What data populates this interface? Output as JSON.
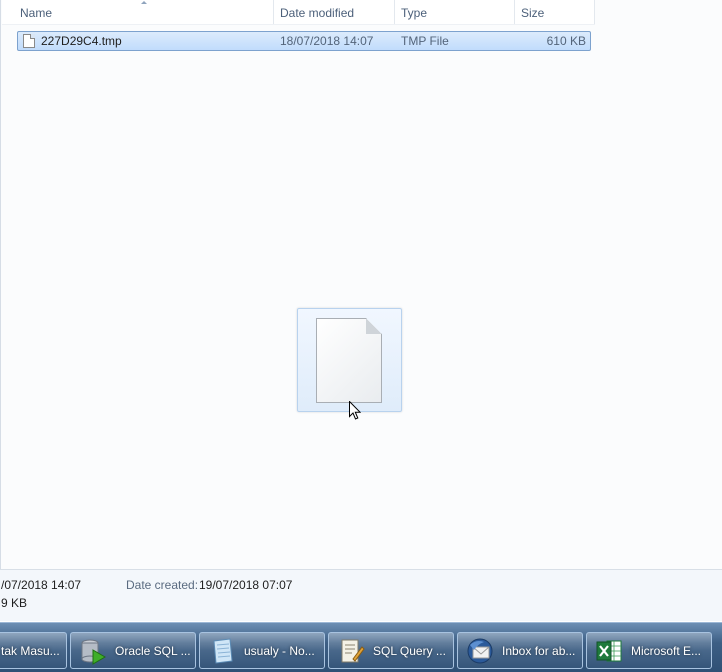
{
  "columns": {
    "name": "Name",
    "date_modified": "Date modified",
    "type": "Type",
    "size": "Size"
  },
  "files": [
    {
      "name": "227D29C4.tmp",
      "date_modified": "18/07/2018 14:07",
      "type": "TMP File",
      "size": "610 KB",
      "selected": true
    }
  ],
  "drag_preview": {
    "icon": "document-icon"
  },
  "details": {
    "date_modified_partial": "/07/2018 14:07",
    "date_created_label": "Date created:",
    "date_created": "19/07/2018 07:07",
    "size_partial": "9 KB"
  },
  "taskbar": {
    "buttons": [
      {
        "label": "tak Masu...",
        "icon": "none"
      },
      {
        "label": "Oracle SQL ...",
        "icon": "oracle-sql-developer-icon"
      },
      {
        "label": "usualy - No...",
        "icon": "notepad-icon"
      },
      {
        "label": "SQL Query ...",
        "icon": "sql-query-icon"
      },
      {
        "label": "Inbox for ab...",
        "icon": "thunderbird-icon"
      },
      {
        "label": "Microsoft E...",
        "icon": "excel-icon"
      }
    ]
  },
  "colors": {
    "selection_border": "#7da2ce",
    "selection_fill": "#c9e0fc",
    "header_text": "#4c607a",
    "taskbar": "#3d5f85"
  }
}
